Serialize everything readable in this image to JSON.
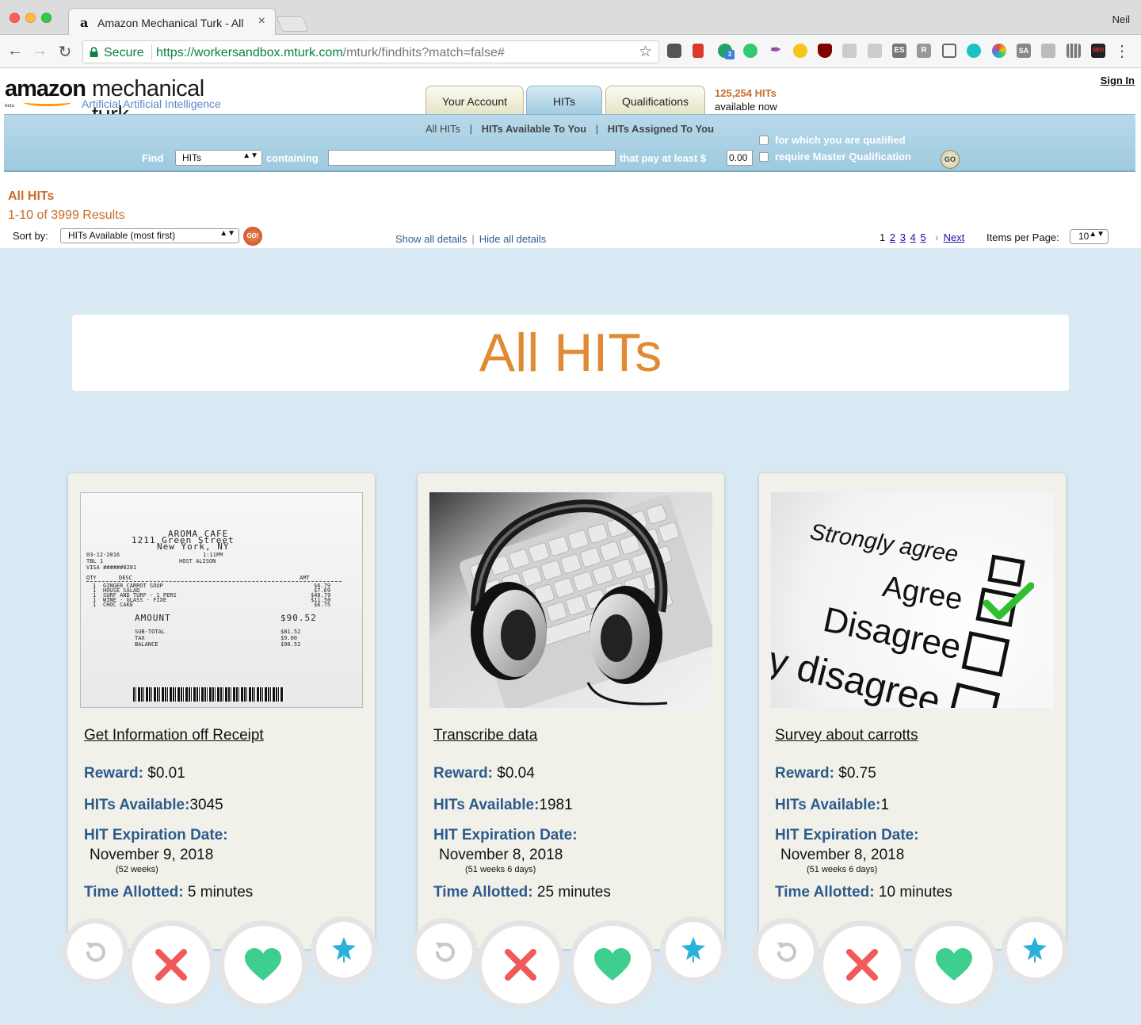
{
  "browser": {
    "tab_title": "Amazon Mechanical Turk - All",
    "tab_favicon": "a",
    "tab_close": "×",
    "user": "Neil",
    "secure_label": "Secure",
    "url_host": "https://workersandbox.mturk.com",
    "url_path": "/mturk/findhits?match=false#",
    "extensions": [
      "pocket-icon",
      "bookmark-icon",
      "chat-icon",
      "id-icon",
      "feather-icon",
      "emoji-icon",
      "ublock-icon",
      "chart-icon",
      "css-icon",
      "es-icon",
      "r-icon",
      "cast-icon",
      "m-icon",
      "color-icon",
      "sa-icon",
      "k-icon",
      "bars-icon",
      "seo-icon"
    ],
    "ext_labels": {
      "chat_badge": "3",
      "es": "ES",
      "r": "R",
      "sa": "SA",
      "seo": "SEO"
    }
  },
  "header": {
    "logo_amazon": "amazon",
    "logo_mech": "mechanical turk",
    "logo_sub": "Artificial Artificial Intelligence",
    "logo_beta": "beta",
    "tabs": [
      {
        "label": "Your Account"
      },
      {
        "label": "HITs"
      },
      {
        "label": "Qualifications"
      }
    ],
    "hits_count": "125,254 HITs",
    "hits_now": "available now",
    "sign_in": "Sign In"
  },
  "search": {
    "subnav": [
      "All HITs",
      "HITs Available To You",
      "HITs Assigned To You"
    ],
    "sep": "|",
    "find_label": "Find",
    "find_value": "HITs",
    "containing_label": "containing",
    "containing_value": "",
    "pay_label": "that pay at least $",
    "pay_value": "0.00",
    "qualified_label": "for which you are qualified",
    "master_label": "require Master Qualification",
    "go_label": "GO"
  },
  "listing": {
    "title": "All HITs",
    "results": "1-10 of 3999 Results",
    "sort_label": "Sort by:",
    "sort_value": "HITs Available (most first)",
    "go_label": "GO!",
    "show_details": "Show all details",
    "hide_details": "Hide all details",
    "pipe": "|",
    "pager_current": "1",
    "pager_pages": [
      "2",
      "3",
      "4",
      "5"
    ],
    "pager_next": "Next",
    "ipp_label": "Items per Page:",
    "ipp_value": "10"
  },
  "banner": {
    "title": "All HITs"
  },
  "labels": {
    "reward": "Reward:",
    "available": "HITs Available:",
    "expiration": "HIT Expiration Date:",
    "time": "Time Allotted:"
  },
  "cards": [
    {
      "title": "Get Information off Receipt",
      "reward": "$0.01",
      "available": "3045",
      "expiration": "November 9, 2018",
      "weeks": "(52 weeks)",
      "time": "5 minutes"
    },
    {
      "title": "Transcribe data",
      "reward": "$0.04",
      "available": "1981",
      "expiration": "November 8, 2018",
      "weeks": "(51 weeks 6 days)",
      "time": "25 minutes"
    },
    {
      "title": "Survey about carrotts",
      "reward": "$0.75",
      "available": "1",
      "expiration": "November 8, 2018",
      "weeks": "(51 weeks 6 days)",
      "time": "10 minutes"
    }
  ],
  "receipt": {
    "name": "AROMA CAFE",
    "street": "1211 Green Street",
    "city": "New York, NY",
    "date": "03-12-2016",
    "time": "1:11PM",
    "table": "TBL 1",
    "host": "HOST ALISON",
    "visa": "VISA ######8281",
    "col_qty": "QTY",
    "col_desc": "DESC",
    "col_amt": "AMT",
    "items": [
      {
        "qty": "1",
        "desc": "GINGER CARROT SOUP",
        "amt": "$6.79"
      },
      {
        "qty": "1",
        "desc": "HOUSE SALAD",
        "amt": "$7.69"
      },
      {
        "qty": "1",
        "desc": "SURF AND TURF - 1 PERS",
        "amt": "$48.79"
      },
      {
        "qty": "1",
        "desc": "WINE - GLASS - FIXE",
        "amt": "$11.50"
      },
      {
        "qty": "1",
        "desc": "CHOC CAKE",
        "amt": "$6.75"
      }
    ],
    "amount_label": "AMOUNT",
    "amount": "$90.52",
    "subtotal_label": "SUB-TOTAL",
    "subtotal": "$81.52",
    "tax_label": "TAX",
    "tax": "$9.00",
    "balance_label": "BALANCE",
    "balance": "$90.52"
  },
  "survey": {
    "strongly_agree": "Strongly agree",
    "agree": "Agree",
    "disagree": "Disagree",
    "strongly_disagree": "ly disagree"
  },
  "colors": {
    "accent_orange": "#c96c28",
    "banner_orange": "#e08a32",
    "label_blue": "#2c5a8c",
    "bg_blue": "#d9e9f4",
    "reject_red": "#f05a5a",
    "like_green": "#3ecf8e",
    "star_teal": "#2bb0d8"
  }
}
